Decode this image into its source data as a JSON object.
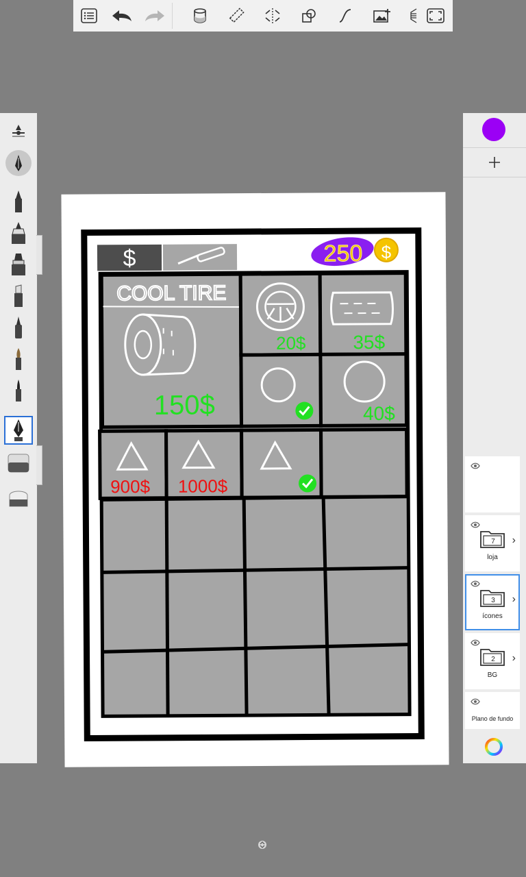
{
  "colors": {
    "current_color": "#9b00f5",
    "grid_fill": "#a6a6a6",
    "price_green": "#22e022",
    "price_red": "#ee1111",
    "coins_purple": "#8a1ff0",
    "coins_gold": "#f5c400"
  },
  "toolbar": {
    "icons": [
      "list-icon",
      "undo-icon",
      "redo-icon",
      "bucket-icon",
      "ruler-icon",
      "symmetry-icon",
      "shapes-icon",
      "curve-icon",
      "image-add-icon",
      "perspective-icon",
      "fullscreen-icon"
    ]
  },
  "layers": [
    {
      "name": "",
      "visible": true
    },
    {
      "name": "loja",
      "count": "7",
      "visible": true
    },
    {
      "name": "ícones",
      "count": "3",
      "visible": true,
      "selected": true
    },
    {
      "name": "BG",
      "count": "2",
      "visible": true
    },
    {
      "name": "Plano de fundo",
      "visible": true
    }
  ],
  "drawing": {
    "tab_dollar": "$",
    "coins": "250",
    "featured_title": "COOL TIRE",
    "featured_price": "150$",
    "items_row1": [
      "20$",
      "35$"
    ],
    "items_row2": [
      "",
      "40$"
    ],
    "items_row3": [
      "900$",
      "1000$"
    ]
  }
}
